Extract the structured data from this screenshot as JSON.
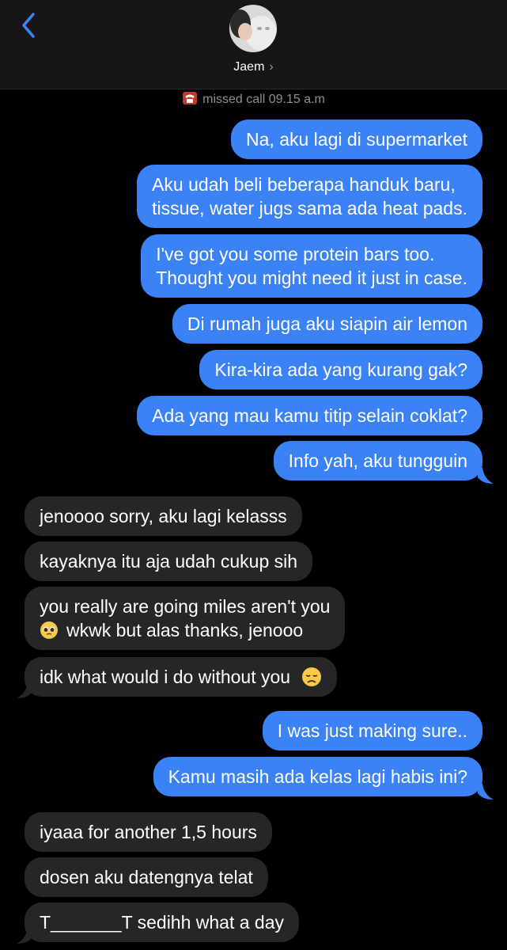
{
  "header": {
    "contact_name": "Jaem",
    "chevron": "›",
    "back_icon": "chevron-left-icon",
    "accent_color": "#3b82f7"
  },
  "status": {
    "missed_call": "missed call 09.15 a.m",
    "icon": "telephone-icon"
  },
  "messages": {
    "m1": "Na, aku lagi di supermarket",
    "m2a": "Aku udah beli beberapa handuk baru,",
    "m2b": "tissue, water jugs sama ada heat pads.",
    "m3a": "I've got you some protein bars too.",
    "m3b": "Thought you might need it just in case.",
    "m4": "Di rumah juga aku siapin air lemon",
    "m5": "Kira-kira ada yang kurang gak?",
    "m6": "Ada yang mau kamu titip selain coklat?",
    "m7": "Info yah, aku tungguin",
    "r1": "jenoooo sorry, aku lagi kelasss",
    "r2": "kayaknya itu aja udah cukup sih",
    "r3a": "you really are going miles aren't you",
    "r3b": "wkwk but alas thanks, jenooo",
    "r4": "idk what would i do without you",
    "m8": "I was just making sure..",
    "m9": "Kamu masih ada kelas lagi habis ini?",
    "r5": "iyaaa for another 1,5 hours",
    "r6": "dosen aku datengnya telat",
    "r7": "T_______T sedihh what a day"
  },
  "colors": {
    "outgoing": "#3b82f7",
    "incoming": "#262628",
    "background": "#000000"
  }
}
